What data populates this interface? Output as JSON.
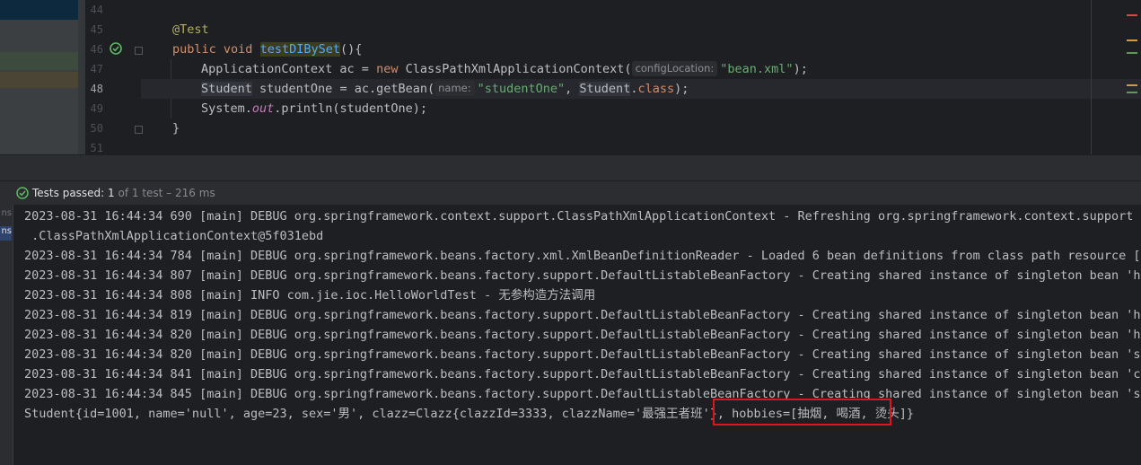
{
  "editor": {
    "line_numbers": [
      "44",
      "45",
      "46",
      "47",
      "48",
      "49",
      "50",
      "51"
    ],
    "code": {
      "l45_annotation": "@Test",
      "l46_kw1": "public",
      "l46_kw2": "void",
      "l46_method": "testDIBySet",
      "l46_rest": "(){",
      "l47_type": "ApplicationContext ac = ",
      "l47_new": "new",
      "l47_ctor": " ClassPathXmlApplicationContext(",
      "l47_hint": "configLocation:",
      "l47_str": "\"bean.xml\"",
      "l47_end": ");",
      "l48_type": "Student",
      "l48_mid": " studentOne = ac.getBean(",
      "l48_hint": "name:",
      "l48_str": "\"studentOne\"",
      "l48_comma": ", ",
      "l48_cls": "Student",
      "l48_dot": ".",
      "l48_class_kw": "class",
      "l48_end": ");",
      "l49_a": "System.",
      "l49_out": "out",
      "l49_b": ".println(studentOne);",
      "l50": "}"
    },
    "scroll_marker_colors": [
      "#c94f4f",
      "#d19a3d",
      "#5a9e52",
      "#d19a3d",
      "#5a9e52"
    ]
  },
  "test_status": {
    "icon": "check-circle-icon",
    "label": "Tests passed:",
    "passed": "1",
    "of_text": "of 1 test",
    "duration": "– 216 ms"
  },
  "left_tabs": [
    "ns",
    "ns"
  ],
  "console": {
    "lines": [
      "2023-08-31 16:44:34 690 [main] DEBUG org.springframework.context.support.ClassPathXmlApplicationContext - Refreshing org.springframework.context.support",
      " .ClassPathXmlApplicationContext@5f031ebd",
      "2023-08-31 16:44:34 784 [main] DEBUG org.springframework.beans.factory.xml.XmlBeanDefinitionReader - Loaded 6 bean definitions from class path resource [bea",
      "2023-08-31 16:44:34 807 [main] DEBUG org.springframework.beans.factory.support.DefaultListableBeanFactory - Creating shared instance of singleton bean 'hell",
      "2023-08-31 16:44:34 808 [main] INFO com.jie.ioc.HelloWorldTest - 无参构造方法调用",
      "2023-08-31 16:44:34 819 [main] DEBUG org.springframework.beans.factory.support.DefaultListableBeanFactory - Creating shared instance of singleton bean 'hell",
      "2023-08-31 16:44:34 820 [main] DEBUG org.springframework.beans.factory.support.DefaultListableBeanFactory - Creating shared instance of singleton bean 'hell",
      "2023-08-31 16:44:34 820 [main] DEBUG org.springframework.beans.factory.support.DefaultListableBeanFactory - Creating shared instance of singleton bean 'stud",
      "2023-08-31 16:44:34 841 [main] DEBUG org.springframework.beans.factory.support.DefaultListableBeanFactory - Creating shared instance of singleton bean 'claz",
      "2023-08-31 16:44:34 845 [main] DEBUG org.springframework.beans.factory.support.DefaultListableBeanFactory - Creating shared instance of singleton bean 'stud",
      "Student{id=1001, name='null', age=23, sex='男', clazz=Clazz{clazzId=3333, clazzName='最强王者班'}, hobbies=[抽烟, 喝酒, 烫头]}"
    ],
    "highlight_color": "#e0141e"
  }
}
